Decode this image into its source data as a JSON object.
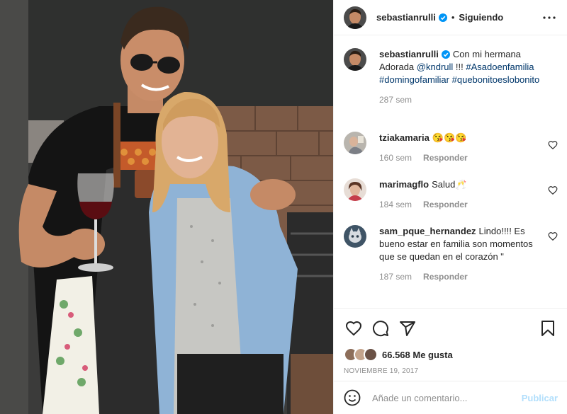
{
  "header": {
    "username": "sebastianrulli",
    "separator": "•",
    "following_label": "Siguiendo"
  },
  "caption": {
    "username": "sebastianrulli",
    "text": "Con mi hermana Adorada",
    "mention": "@kndrull",
    "exclamations": "!!!",
    "hashtags": [
      "#Asadoenfamilia",
      "#domingofamiliar",
      "#quebonitoeslobonito"
    ],
    "time": "287 sem"
  },
  "comments": [
    {
      "username": "tziakamaria",
      "text": "😘😘😘",
      "time": "160 sem",
      "reply_label": "Responder"
    },
    {
      "username": "marimagflo",
      "text": "Salud🥂",
      "time": "184 sem",
      "reply_label": "Responder"
    },
    {
      "username": "sam_pque_hernandez",
      "text": "Lindo!!!! Es bueno estar en familia son momentos que se quedan en el corazón \"",
      "time": "187 sem",
      "reply_label": "Responder"
    }
  ],
  "actions": {
    "likes": "66.568 Me gusta",
    "date": "NOVIEMBRE 19, 2017"
  },
  "add_comment": {
    "placeholder": "Añade un comentario...",
    "publish_label": "Publicar"
  },
  "icons": {
    "verified": "verified-badge-icon",
    "more": "more-options-icon",
    "like": "heart-icon",
    "comment": "comment-bubble-icon",
    "share": "paper-plane-icon",
    "save": "bookmark-icon",
    "emoji": "smiley-icon"
  },
  "colors": {
    "verified_blue": "#0095f6",
    "link": "#00376b",
    "muted": "#8e8e8e",
    "publish_disabled": "#b2dffc"
  }
}
